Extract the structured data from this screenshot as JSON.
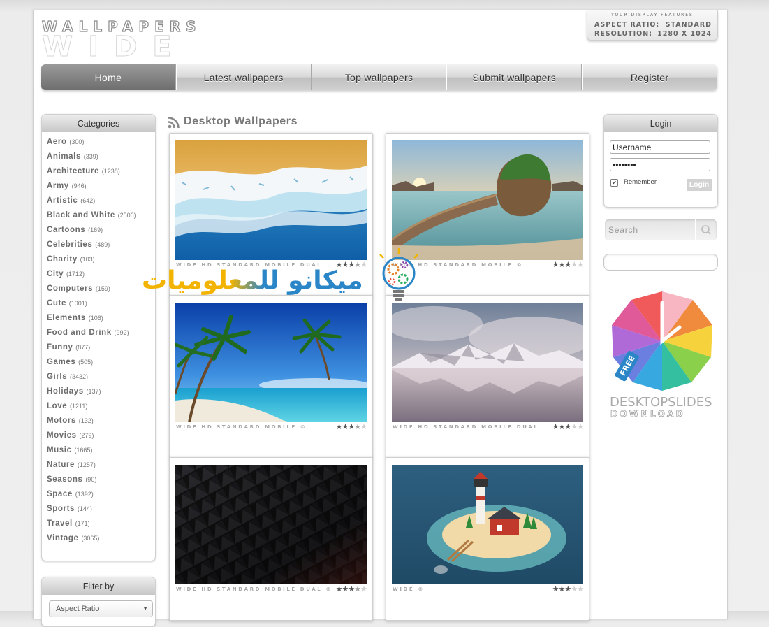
{
  "logo": {
    "line1": "WALLPAPERS",
    "line2": "WIDE"
  },
  "display_features": {
    "title": "YOUR DISPLAY FEATURES",
    "aspect_label": "ASPECT RATIO:",
    "aspect_value": "STANDARD",
    "resolution_label": "RESOLUTION:",
    "resolution_value": "1280 X 1024"
  },
  "nav": [
    "Home",
    "Latest wallpapers",
    "Top wallpapers",
    "Submit wallpapers",
    "Register"
  ],
  "categories": {
    "title": "Categories",
    "items": [
      {
        "name": "Aero",
        "count": "(300)"
      },
      {
        "name": "Animals",
        "count": "(339)"
      },
      {
        "name": "Architecture",
        "count": "(1238)"
      },
      {
        "name": "Army",
        "count": "(946)"
      },
      {
        "name": "Artistic",
        "count": "(642)"
      },
      {
        "name": "Black and White",
        "count": "(2506)"
      },
      {
        "name": "Cartoons",
        "count": "(169)"
      },
      {
        "name": "Celebrities",
        "count": "(489)"
      },
      {
        "name": "Charity",
        "count": "(103)"
      },
      {
        "name": "City",
        "count": "(1712)"
      },
      {
        "name": "Computers",
        "count": "(159)"
      },
      {
        "name": "Cute",
        "count": "(1001)"
      },
      {
        "name": "Elements",
        "count": "(106)"
      },
      {
        "name": "Food and Drink",
        "count": "(992)"
      },
      {
        "name": "Funny",
        "count": "(877)"
      },
      {
        "name": "Games",
        "count": "(505)"
      },
      {
        "name": "Girls",
        "count": "(3432)"
      },
      {
        "name": "Holidays",
        "count": "(137)"
      },
      {
        "name": "Love",
        "count": "(1211)"
      },
      {
        "name": "Motors",
        "count": "(132)"
      },
      {
        "name": "Movies",
        "count": "(279)"
      },
      {
        "name": "Music",
        "count": "(1665)"
      },
      {
        "name": "Nature",
        "count": "(1257)"
      },
      {
        "name": "Seasons",
        "count": "(90)"
      },
      {
        "name": "Space",
        "count": "(1392)"
      },
      {
        "name": "Sports",
        "count": "(144)"
      },
      {
        "name": "Travel",
        "count": "(171)"
      },
      {
        "name": "Vintage",
        "count": "(3065)"
      }
    ]
  },
  "filter": {
    "title": "Filter by",
    "select_value": "Aspect Ratio"
  },
  "main": {
    "title": "Desktop Wallpapers",
    "wallpapers": [
      {
        "scene": "ocean-waves-sand",
        "tags": "WIDE HD STANDARD MOBILE DUAL",
        "rating": 3.5
      },
      {
        "scene": "rock-island-bridge",
        "tags": "WIDE HD STANDARD MOBILE ©",
        "rating": 3
      },
      {
        "scene": "tropical-beach-palms",
        "tags": "WIDE HD STANDARD MOBILE ©",
        "rating": 3.5
      },
      {
        "scene": "snowy-mountains-lake",
        "tags": "WIDE HD STANDARD MOBILE DUAL",
        "rating": 3
      },
      {
        "scene": "dark-triangle-pattern",
        "tags": "WIDE HD STANDARD MOBILE DUAL ©",
        "rating": 3.5
      },
      {
        "scene": "lighthouse-island",
        "tags": "WIDE ©",
        "rating": 3
      }
    ]
  },
  "watermark": {
    "text": "ميكانو للمعلوميات"
  },
  "login": {
    "title": "Login",
    "username": "Username",
    "password": "••••••••",
    "remember_label": "Remember",
    "remember_checked": true,
    "button": "Login"
  },
  "search": {
    "placeholder": "Search"
  },
  "ad": {
    "line1": "DESKTOPSLIDES",
    "line2": "DOWNLOAD",
    "tag": "FREE"
  },
  "colors": {
    "nav_active": "#7d7d7d",
    "accent_gray": "#777777",
    "watermark_yellow": "#f2b400",
    "watermark_blue": "#2a86c7"
  }
}
